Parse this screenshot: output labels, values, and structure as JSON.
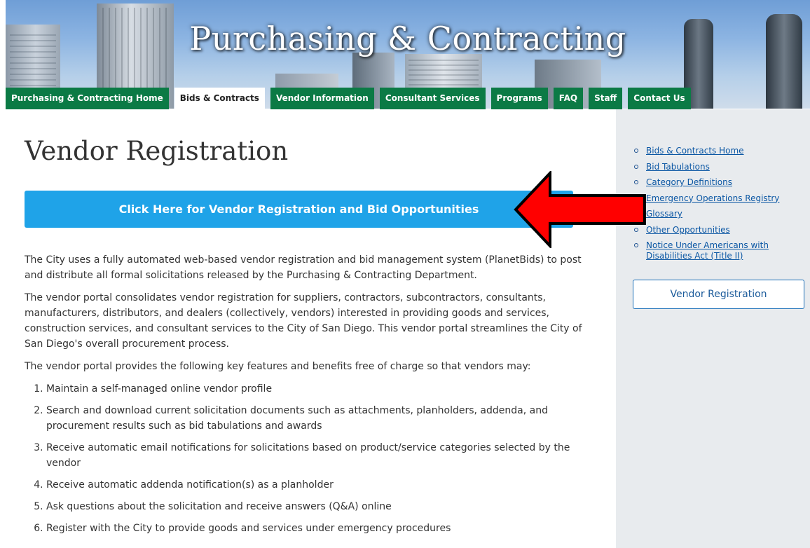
{
  "banner": {
    "title": "Purchasing & Contracting"
  },
  "nav": {
    "tabs": [
      {
        "label": "Purchasing & Contracting Home"
      },
      {
        "label": "Bids & Contracts"
      },
      {
        "label": "Vendor Information"
      },
      {
        "label": "Consultant Services"
      },
      {
        "label": "Programs"
      },
      {
        "label": "FAQ"
      },
      {
        "label": "Staff"
      },
      {
        "label": "Contact Us"
      }
    ],
    "active_tab": "Bids & Contracts"
  },
  "main": {
    "title": "Vendor Registration",
    "cta_label": "Click Here for Vendor Registration and Bid Opportunities",
    "paragraphs": [
      "The City uses a fully automated web-based vendor registration and bid management system (PlanetBids) to post and distribute all formal solicitations released by the Purchasing & Contracting Department.",
      "The vendor portal consolidates vendor registration for suppliers, contractors, subcontractors, consultants, manufacturers, distributors, and dealers (collectively, vendors) interested in providing goods and services, construction services, and consultant services to the City of San Diego. This vendor portal streamlines the City of San Diego's overall procurement process.",
      "The vendor portal provides the following key features and benefits free of charge so that vendors may:"
    ],
    "features": [
      "Maintain a self-managed online vendor profile",
      "Search and download current solicitation documents such as attachments, planholders, addenda, and procurement results such as bid tabulations and awards",
      "Receive automatic email notifications for solicitations based on product/service categories selected by the vendor",
      "Receive automatic addenda notification(s) as a planholder",
      "Ask questions about the solicitation and receive answers (Q&A) online",
      "Register with the City to provide goods and services under emergency procedures"
    ]
  },
  "sidebar": {
    "links": [
      "Bids & Contracts Home",
      "Bid Tabulations",
      "Category Definitions",
      "Emergency Operations Registry",
      "Glossary",
      "Other Opportunities",
      "Notice Under Americans with Disabilities Act (Title II)"
    ],
    "button_label": "Vendor Registration"
  },
  "colors": {
    "tab_green": "#0b7a45",
    "cta_blue": "#1fa3e8",
    "arrow_red": "#ff0000",
    "sidebar_bg": "#e8ebee",
    "link_blue": "#0b57a4"
  }
}
